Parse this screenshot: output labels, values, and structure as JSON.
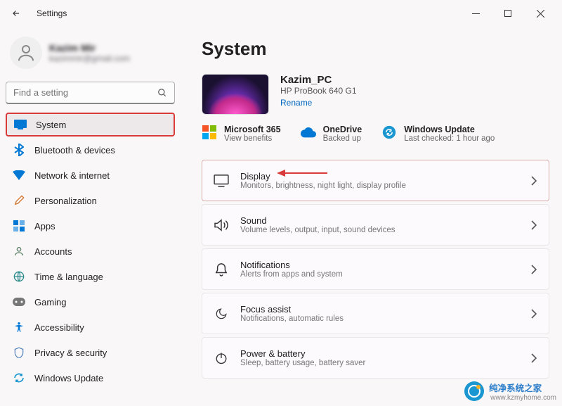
{
  "titlebar": {
    "app_title": "Settings"
  },
  "user": {
    "name": "Kazim Mir",
    "email": "kazimmir@gmail.com"
  },
  "search": {
    "placeholder": "Find a setting"
  },
  "nav": [
    {
      "label": "System",
      "icon": "system",
      "active": true
    },
    {
      "label": "Bluetooth & devices",
      "icon": "bluetooth"
    },
    {
      "label": "Network & internet",
      "icon": "wifi"
    },
    {
      "label": "Personalization",
      "icon": "brush"
    },
    {
      "label": "Apps",
      "icon": "apps"
    },
    {
      "label": "Accounts",
      "icon": "accounts"
    },
    {
      "label": "Time & language",
      "icon": "globe"
    },
    {
      "label": "Gaming",
      "icon": "gaming"
    },
    {
      "label": "Accessibility",
      "icon": "accessibility"
    },
    {
      "label": "Privacy & security",
      "icon": "shield"
    },
    {
      "label": "Windows Update",
      "icon": "update"
    }
  ],
  "page": {
    "title": "System"
  },
  "device": {
    "name": "Kazim_PC",
    "model": "HP ProBook 640 G1",
    "rename_label": "Rename"
  },
  "status": [
    {
      "title": "Microsoft 365",
      "sub": "View benefits",
      "icon": "ms365"
    },
    {
      "title": "OneDrive",
      "sub": "Backed up",
      "icon": "onedrive"
    },
    {
      "title": "Windows Update",
      "sub": "Last checked: 1 hour ago",
      "icon": "update2"
    }
  ],
  "settings": [
    {
      "title": "Display",
      "sub": "Monitors, brightness, night light, display profile",
      "icon": "display",
      "highlighted": true
    },
    {
      "title": "Sound",
      "sub": "Volume levels, output, input, sound devices",
      "icon": "sound"
    },
    {
      "title": "Notifications",
      "sub": "Alerts from apps and system",
      "icon": "bell"
    },
    {
      "title": "Focus assist",
      "sub": "Notifications, automatic rules",
      "icon": "moon"
    },
    {
      "title": "Power & battery",
      "sub": "Sleep, battery usage, battery saver",
      "icon": "power"
    }
  ],
  "watermark": {
    "title": "纯净系统之家",
    "sub": "www.kzmyhome.com"
  }
}
